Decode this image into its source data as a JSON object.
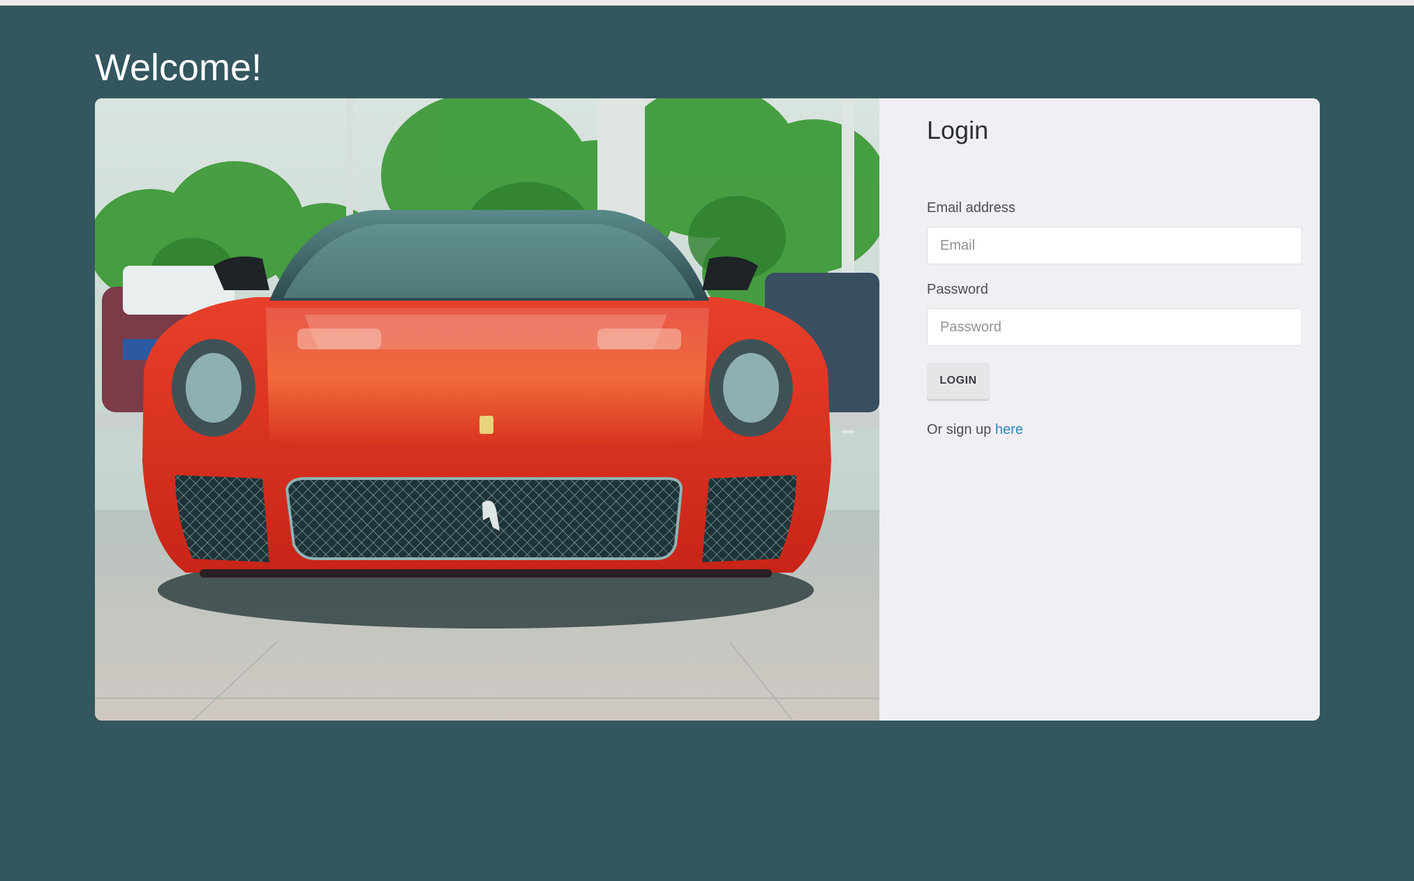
{
  "page": {
    "title": "Welcome!"
  },
  "login": {
    "heading": "Login",
    "email_label": "Email address",
    "email_placeholder": "Email",
    "email_value": "",
    "password_label": "Password",
    "password_placeholder": "Password",
    "password_value": "",
    "button_label": "LOGIN",
    "signup_prefix": "Or sign up",
    "signup_link": "here"
  },
  "colors": {
    "page_background": "#33565f",
    "card_background": "#f0eff4",
    "link": "#2a87b6",
    "car_body": "#d8321e"
  },
  "images": {
    "hero": "red-sports-car-front-view"
  }
}
